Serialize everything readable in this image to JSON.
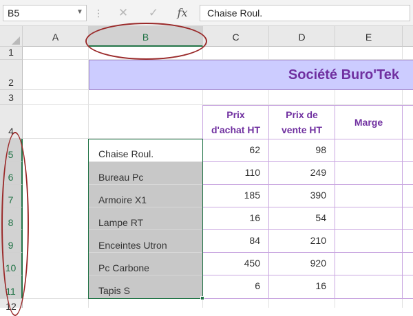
{
  "formula_bar": {
    "name_box": "B5",
    "formula": "Chaise Roul.",
    "icons": [
      "cancel-icon",
      "enter-icon",
      "insert-function-icon"
    ]
  },
  "columns": [
    "A",
    "B",
    "C",
    "D",
    "E"
  ],
  "selected_column": "B",
  "rows": [
    "1",
    "2",
    "3",
    "4",
    "5",
    "6",
    "7",
    "8",
    "9",
    "10",
    "11",
    "12"
  ],
  "title": "Société Buro'Tek",
  "table": {
    "headers": [
      "Prix\nd'achat HT",
      "Prix de\nvente HT",
      "Marge"
    ],
    "items": [
      {
        "name": "Chaise Roul.",
        "achat": "62",
        "vente": "98"
      },
      {
        "name": "Bureau Pc",
        "achat": "110",
        "vente": "249"
      },
      {
        "name": "Armoire X1",
        "achat": "185",
        "vente": "390"
      },
      {
        "name": "Lampe RT",
        "achat": "16",
        "vente": "54"
      },
      {
        "name": "Enceintes Utron",
        "achat": "84",
        "vente": "210"
      },
      {
        "name": "Pc Carbone",
        "achat": "450",
        "vente": "920"
      },
      {
        "name": "Tapis S",
        "achat": "6",
        "vente": "16"
      }
    ]
  },
  "colors": {
    "accent": "#217346",
    "title_bg": "#ccccff",
    "title_text": "#7030a0",
    "annotation": "#9a2a2a"
  }
}
